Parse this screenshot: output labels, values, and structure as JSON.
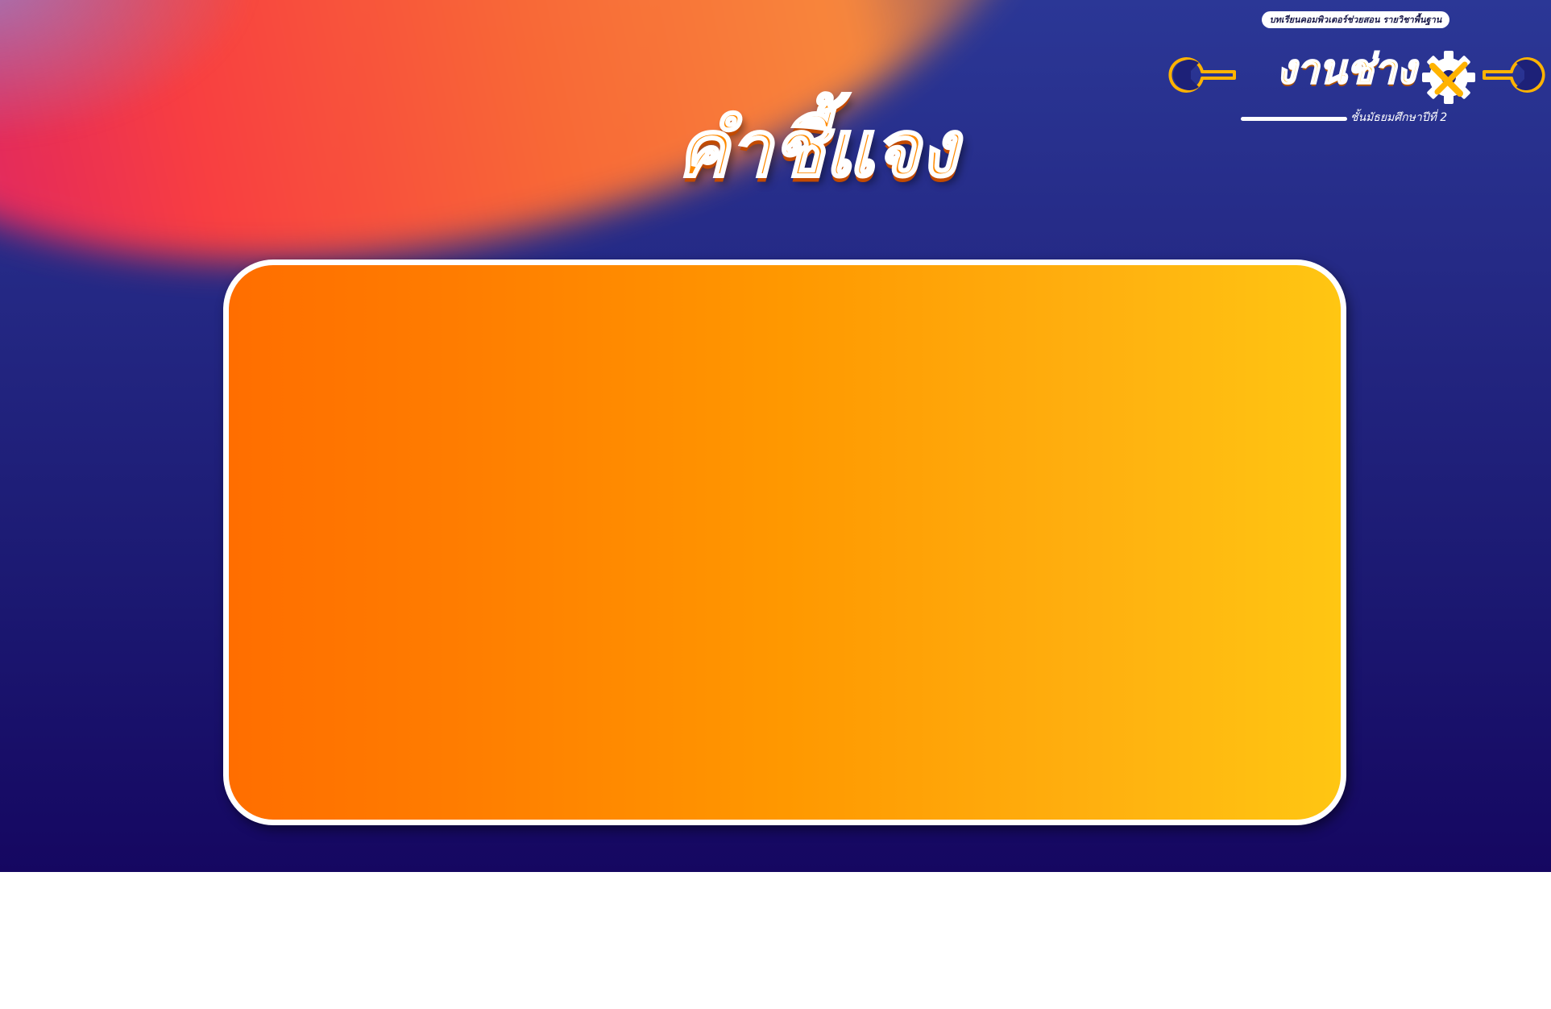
{
  "slide": {
    "title": "คำชี้แจง",
    "content_box": ""
  },
  "logo": {
    "top_text": "บทเรียนคอมพิวเตอร์ช่วยสอน  รายวิชาพื้นฐาน",
    "word": "งานช่าง",
    "subtitle": "ชั้นมัธยมศึกษาปีที่ 2",
    "icons": [
      "wrench-icon",
      "gear-icon",
      "wrench-icon"
    ]
  },
  "colors": {
    "background_top": "#2b3796",
    "background_bottom": "#150761",
    "swoosh_pink": "#ea2a5b",
    "swoosh_orange": "#ff6a34",
    "card_left": "#ff6e00",
    "card_right": "#ffc612",
    "card_border": "#ffffff",
    "title_fill": "#ff8a00",
    "logo_yellow": "#ffb300"
  }
}
